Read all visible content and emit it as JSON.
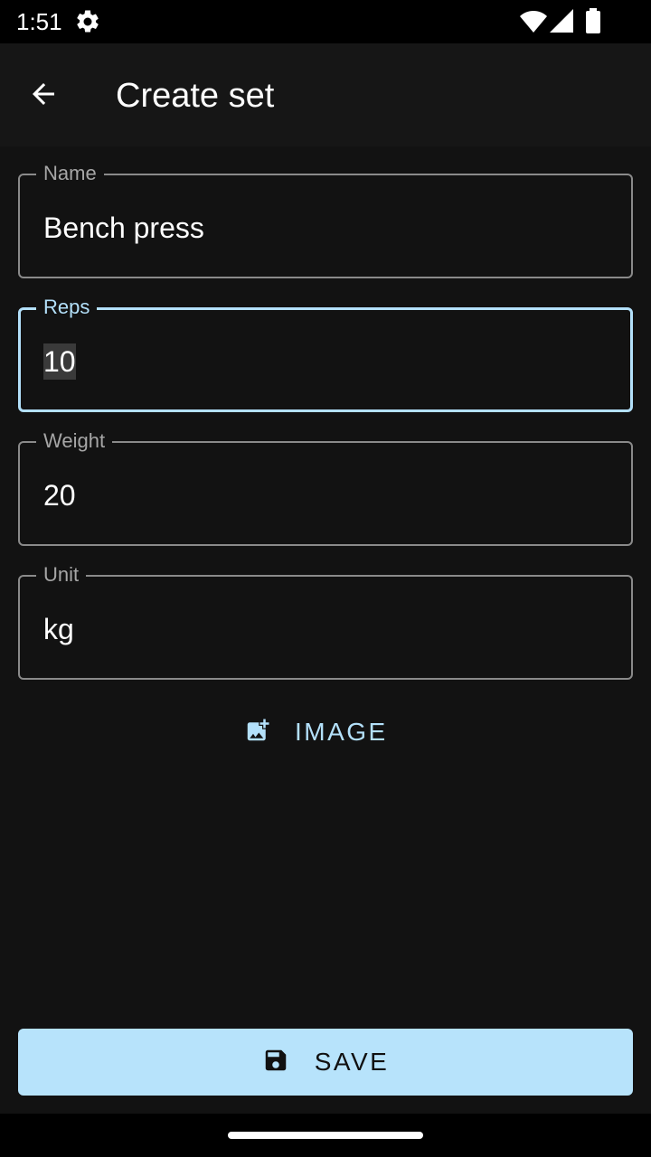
{
  "status_bar": {
    "time": "1:51",
    "icons": [
      "gear-icon",
      "wifi-icon",
      "signal-icon",
      "battery-icon"
    ]
  },
  "app_bar": {
    "title": "Create set",
    "back_icon": "arrow-back-icon"
  },
  "form": {
    "name": {
      "label": "Name",
      "value": "Bench press"
    },
    "reps": {
      "label": "Reps",
      "value": "10",
      "focused": true
    },
    "weight": {
      "label": "Weight",
      "value": "20"
    },
    "unit": {
      "label": "Unit",
      "value": "kg"
    }
  },
  "image_button": {
    "label": "IMAGE",
    "icon": "add-photo-icon"
  },
  "save_button": {
    "label": "SAVE",
    "icon": "save-icon"
  },
  "colors": {
    "accent": "#b3e0fa",
    "background": "#121212",
    "save_button_bg": "#b7e3fb"
  }
}
